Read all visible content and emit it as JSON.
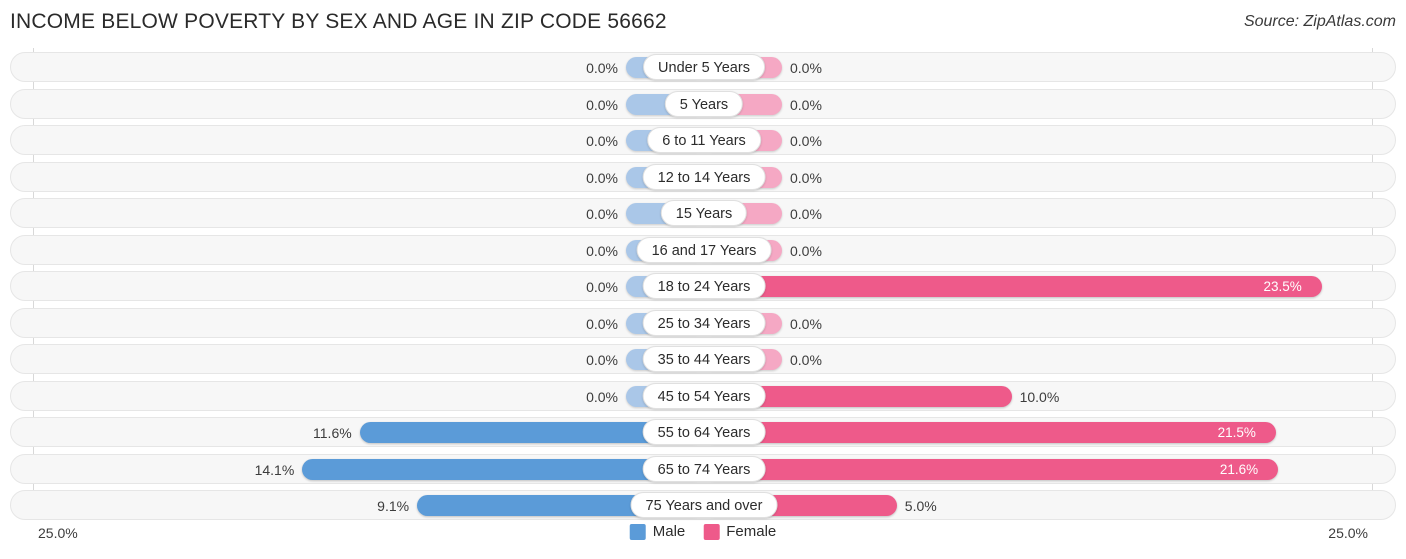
{
  "header": {
    "title": "Income Below Poverty by Sex and Age in Zip Code 56662",
    "source": "Source: ZipAtlas.com"
  },
  "legend": {
    "male_label": "Male",
    "female_label": "Female",
    "male_color": "#5b9bd8",
    "female_color": "#ee5a8a",
    "male_color_muted": "#aac7e8",
    "female_color_muted": "#f5a8c4"
  },
  "axis": {
    "left_tick": "25.0%",
    "right_tick": "25.0%",
    "max": 25.0
  },
  "chart_data": {
    "type": "bar",
    "orientation": "horizontal-diverging",
    "title": "Income Below Poverty by Sex and Age in Zip Code 56662",
    "xlabel": "",
    "ylabel": "",
    "xlim": [
      -25.0,
      25.0
    ],
    "grid": false,
    "legend_position": "bottom-center",
    "categories": [
      "Under 5 Years",
      "5 Years",
      "6 to 11 Years",
      "12 to 14 Years",
      "15 Years",
      "16 and 17 Years",
      "18 to 24 Years",
      "25 to 34 Years",
      "35 to 44 Years",
      "45 to 54 Years",
      "55 to 64 Years",
      "65 to 74 Years",
      "75 Years and over"
    ],
    "series": [
      {
        "name": "Male",
        "values": [
          0.0,
          0.0,
          0.0,
          0.0,
          0.0,
          0.0,
          0.0,
          0.0,
          0.0,
          0.0,
          11.6,
          14.1,
          9.1
        ]
      },
      {
        "name": "Female",
        "values": [
          0.0,
          0.0,
          0.0,
          0.0,
          0.0,
          0.0,
          23.5,
          0.0,
          0.0,
          10.0,
          21.5,
          21.6,
          5.0
        ]
      }
    ],
    "value_labels": {
      "male": [
        "0.0%",
        "0.0%",
        "0.0%",
        "0.0%",
        "0.0%",
        "0.0%",
        "0.0%",
        "0.0%",
        "0.0%",
        "0.0%",
        "11.6%",
        "14.1%",
        "9.1%"
      ],
      "female": [
        "0.0%",
        "0.0%",
        "0.0%",
        "0.0%",
        "0.0%",
        "0.0%",
        "23.5%",
        "0.0%",
        "0.0%",
        "10.0%",
        "21.5%",
        "21.6%",
        "5.0%"
      ]
    }
  }
}
